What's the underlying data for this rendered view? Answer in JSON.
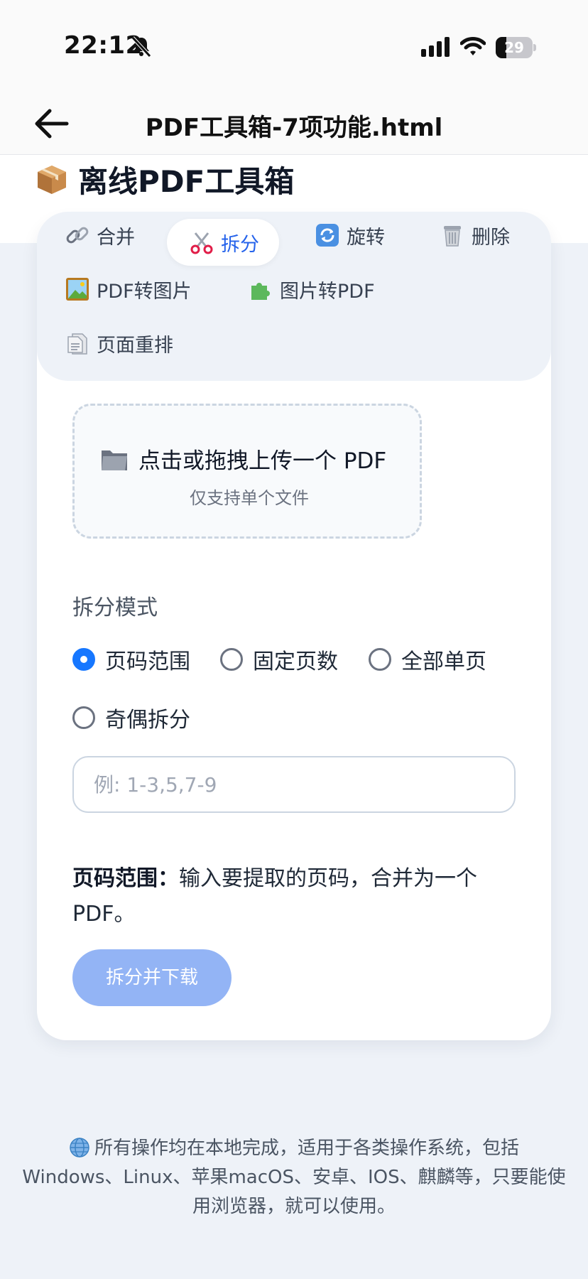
{
  "status": {
    "time": "22:12",
    "battery": "29",
    "battery_level": 0.29
  },
  "nav": {
    "title": "PDF工具箱-7项功能.html"
  },
  "page": {
    "heading": "离线PDF工具箱"
  },
  "tabs": [
    {
      "label": "合并",
      "icon": "link-icon"
    },
    {
      "label": "拆分",
      "icon": "scissors-icon",
      "active": true
    },
    {
      "label": "旋转",
      "icon": "rotate-icon"
    },
    {
      "label": "删除",
      "icon": "trash-icon"
    },
    {
      "label": "PDF转图片",
      "icon": "picture-icon"
    },
    {
      "label": "图片转PDF",
      "icon": "puzzle-icon"
    },
    {
      "label": "页面重排",
      "icon": "document-icon"
    }
  ],
  "upload": {
    "title": "点击或拖拽上传一个 PDF",
    "subtitle": "仅支持单个文件"
  },
  "split": {
    "mode_label": "拆分模式",
    "options": [
      {
        "label": "页码范围",
        "checked": true
      },
      {
        "label": "固定页数",
        "checked": false
      },
      {
        "label": "全部单页",
        "checked": false
      },
      {
        "label": "奇偶拆分",
        "checked": false
      }
    ],
    "input_placeholder": "例: 1-3,5,7-9",
    "desc_title": "页码范围：",
    "desc_text": "输入要提取的页码，合并为一个PDF。",
    "button": "拆分并下载"
  },
  "footer": {
    "text": "所有操作均在本地完成，适用于各类操作系统，包括Windows、Linux、苹果macOS、安卓、IOS、麒麟等，只要能使用浏览器，就可以使用。"
  },
  "colors": {
    "accent": "#2563eb",
    "radio": "#1677ff",
    "button": "#93b4f5",
    "background": "#eef2f8"
  }
}
